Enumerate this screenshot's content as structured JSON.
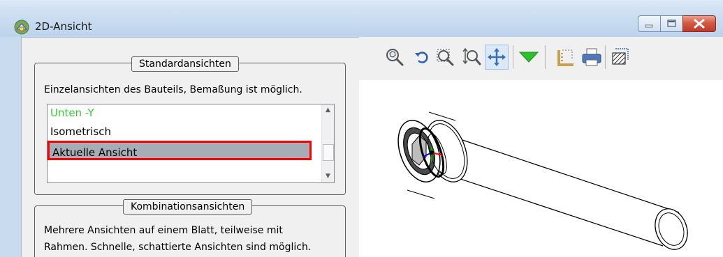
{
  "window": {
    "title": "2D-Ansicht"
  },
  "standard_views": {
    "legend": "Standardansichten",
    "description": "Einzelansichten des Bauteils, Bemaßung ist möglich.",
    "items": [
      {
        "label": "Unten -Y",
        "color": "#33cc33"
      },
      {
        "label": "Isometrisch"
      },
      {
        "label": "Aktuelle Ansicht",
        "selected": true
      }
    ]
  },
  "combination_views": {
    "legend": "Kombinationsansichten",
    "description_line1": "Mehrere Ansichten auf einem Blatt, teilweise mit",
    "description_line2": "Rahmen. Schnelle, schattierte Ansichten sind möglich."
  },
  "colors": {
    "selection_border": "#ff0000",
    "selection_fill": "#a6adb6",
    "accent_green": "#33cc33"
  }
}
